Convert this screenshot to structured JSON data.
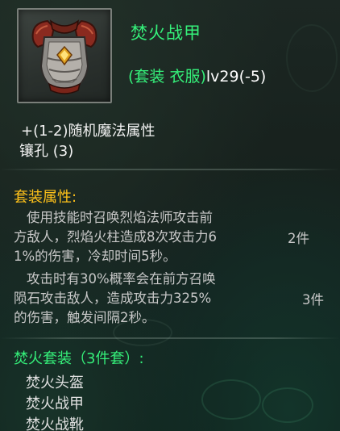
{
  "item": {
    "name": "焚火战甲",
    "set_type": "(套装 衣服)",
    "level_text": "lv29(-5)",
    "icon": "armor-chestplate-icon"
  },
  "attributes": [
    "+(1-2)随机魔法属性",
    "镶孔 (3)"
  ],
  "set_attributes": {
    "heading": "套装属性:",
    "bonus1": {
      "lines": [
        "使用技能时召唤烈焰法师攻击前",
        "方敌人，烈焰火柱造成8次攻击力6",
        "1%的伤害，冷却时间5秒。"
      ],
      "pieces": "2件"
    },
    "bonus2": {
      "lines": [
        "攻击时有30%概率会在前方召唤",
        "陨石攻击敌人，造成攻击力325%",
        "的伤害，触发间隔2秒。"
      ],
      "pieces": "3件"
    }
  },
  "set": {
    "heading": "焚火套装（3件套）:",
    "items": [
      "焚火头盔",
      "焚火战甲",
      "焚火战靴"
    ]
  },
  "colors": {
    "item_name": "#35f07a",
    "section_heading": "#ffc21a",
    "description": "#c8c8c8"
  }
}
